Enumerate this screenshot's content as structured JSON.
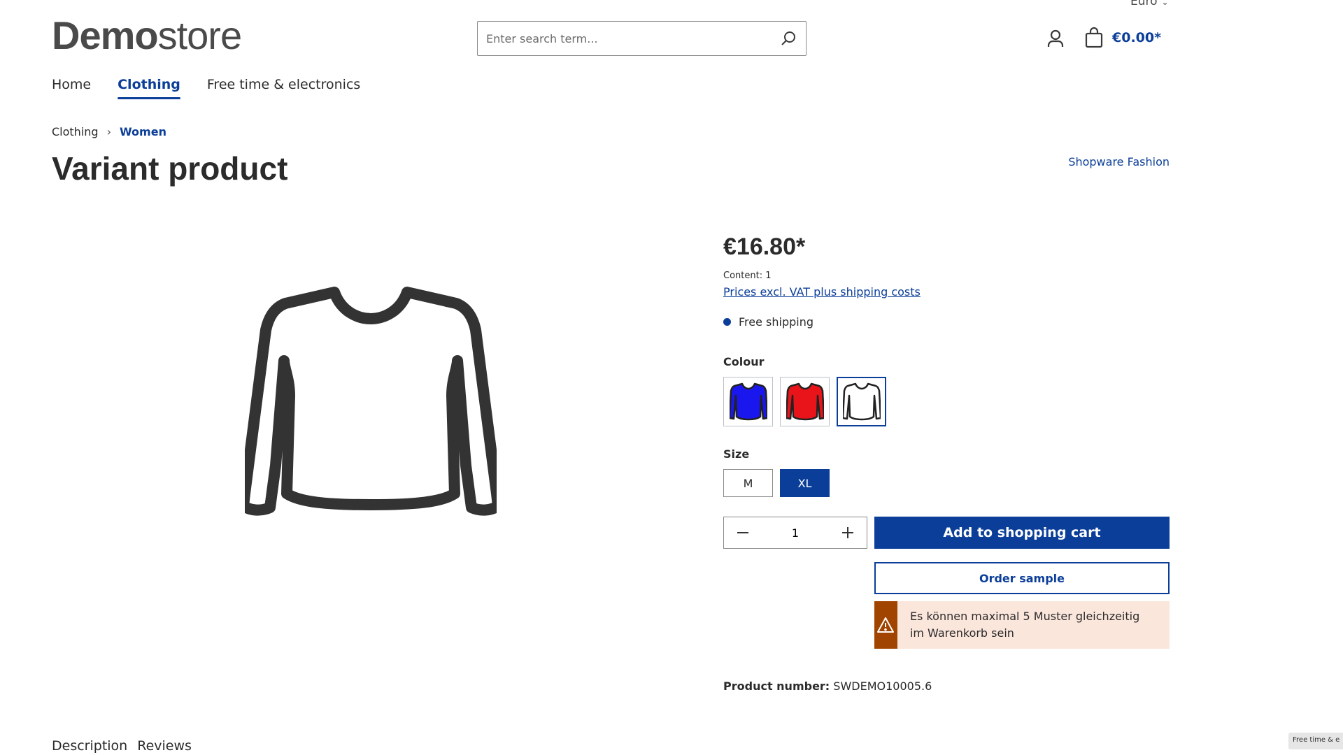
{
  "header": {
    "currency": "Euro",
    "logo": {
      "bold": "Demo",
      "light": "store"
    },
    "search_placeholder": "Enter search term...",
    "cart_total": "€0.00*"
  },
  "nav": {
    "items": [
      {
        "label": "Home",
        "active": false
      },
      {
        "label": "Clothing",
        "active": true
      },
      {
        "label": "Free time & electronics",
        "active": false
      }
    ]
  },
  "breadcrumb": [
    "Clothing",
    "Women"
  ],
  "product": {
    "title": "Variant product",
    "manufacturer": "Shopware Fashion",
    "price": "€16.80*",
    "content": "Content: 1",
    "tax_link": "Prices excl. VAT plus shipping costs",
    "delivery": "Free shipping",
    "colour_label": "Colour",
    "colours": [
      {
        "name": "blue",
        "hex": "#1a17ee",
        "selected": false
      },
      {
        "name": "red",
        "hex": "#e8141a",
        "selected": false
      },
      {
        "name": "white",
        "hex": "#ffffff",
        "selected": true
      }
    ],
    "size_label": "Size",
    "sizes": [
      {
        "label": "M",
        "selected": false
      },
      {
        "label": "XL",
        "selected": true
      }
    ],
    "quantity": "1",
    "add_to_cart": "Add to shopping cart",
    "order_sample": "Order sample",
    "alert": "Es können maximal 5 Muster gleichzeitig im Warenkorb sein",
    "number_label": "Product number:",
    "number_value": "SWDEMO10005.6"
  },
  "tabs": [
    "Description",
    "Reviews"
  ],
  "footer_hint": "Free time & e",
  "colors": {
    "primary": "#0b3e99",
    "warning": "#a04400",
    "warning_bg": "#fbe6dc"
  }
}
